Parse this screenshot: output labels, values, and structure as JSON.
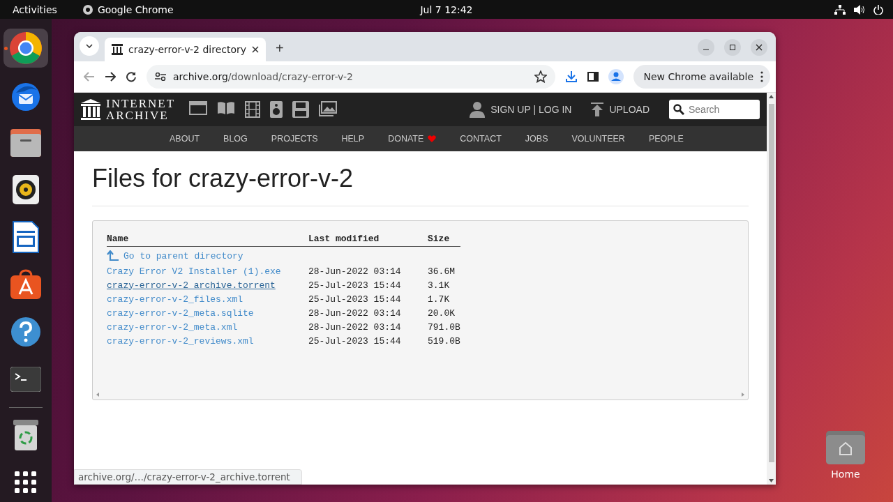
{
  "top_bar": {
    "activities": "Activities",
    "app_name": "Google Chrome",
    "clock": "Jul 7  12:42"
  },
  "dock": {
    "items": [
      {
        "kind": "chrome",
        "running": true
      },
      {
        "kind": "mail",
        "running": false
      },
      {
        "kind": "files",
        "running": false
      },
      {
        "kind": "speaker",
        "running": false
      },
      {
        "kind": "writer",
        "running": false
      },
      {
        "kind": "store",
        "running": false
      },
      {
        "kind": "help",
        "running": false
      },
      {
        "kind": "terminal",
        "running": false
      },
      {
        "kind": "trash",
        "running": false
      },
      {
        "kind": "grid",
        "running": false
      }
    ]
  },
  "browser": {
    "tab_title": "crazy-error-v-2 directory",
    "new_tab": "+",
    "url_host": "archive.org",
    "url_path": "/download/crazy-error-v-2",
    "update_chip": "New Chrome available",
    "status_url": "archive.org/…/crazy-error-v-2_archive.torrent"
  },
  "site": {
    "logo": [
      "INTERNET",
      "ARCHIVE"
    ],
    "auth": "SIGN UP | LOG IN",
    "upload": "UPLOAD",
    "search": {
      "placeholder": "Search"
    },
    "nav": [
      {
        "label": "ABOUT",
        "heart": false
      },
      {
        "label": "BLOG",
        "heart": false
      },
      {
        "label": "PROJECTS",
        "heart": false
      },
      {
        "label": "HELP",
        "heart": false
      },
      {
        "label": "DONATE",
        "heart": true
      },
      {
        "label": "CONTACT",
        "heart": false
      },
      {
        "label": "JOBS",
        "heart": false
      },
      {
        "label": "VOLUNTEER",
        "heart": false
      },
      {
        "label": "PEOPLE",
        "heart": false
      }
    ]
  },
  "listing": {
    "title": "Files for crazy-error-v-2",
    "columns": [
      "Name",
      "Last modified",
      "Size"
    ],
    "parent": "Go to parent directory",
    "rows": [
      {
        "name": "Crazy Error V2 Installer (1).exe",
        "modified": "28-Jun-2022 03:14",
        "size": "36.6M",
        "hovered": false
      },
      {
        "name": "crazy-error-v-2_archive.torrent",
        "modified": "25-Jul-2023 15:44",
        "size": "3.1K",
        "hovered": true
      },
      {
        "name": "crazy-error-v-2_files.xml",
        "modified": "25-Jul-2023 15:44",
        "size": "1.7K",
        "hovered": false
      },
      {
        "name": "crazy-error-v-2_meta.sqlite",
        "modified": "28-Jun-2022 03:14",
        "size": "20.0K",
        "hovered": false
      },
      {
        "name": "crazy-error-v-2_meta.xml",
        "modified": "28-Jun-2022 03:14",
        "size": "791.0B",
        "hovered": false
      },
      {
        "name": "crazy-error-v-2_reviews.xml",
        "modified": "25-Jul-2023 15:44",
        "size": "519.0B",
        "hovered": false
      }
    ]
  },
  "desktop_icons": [
    {
      "label": "Home"
    }
  ]
}
